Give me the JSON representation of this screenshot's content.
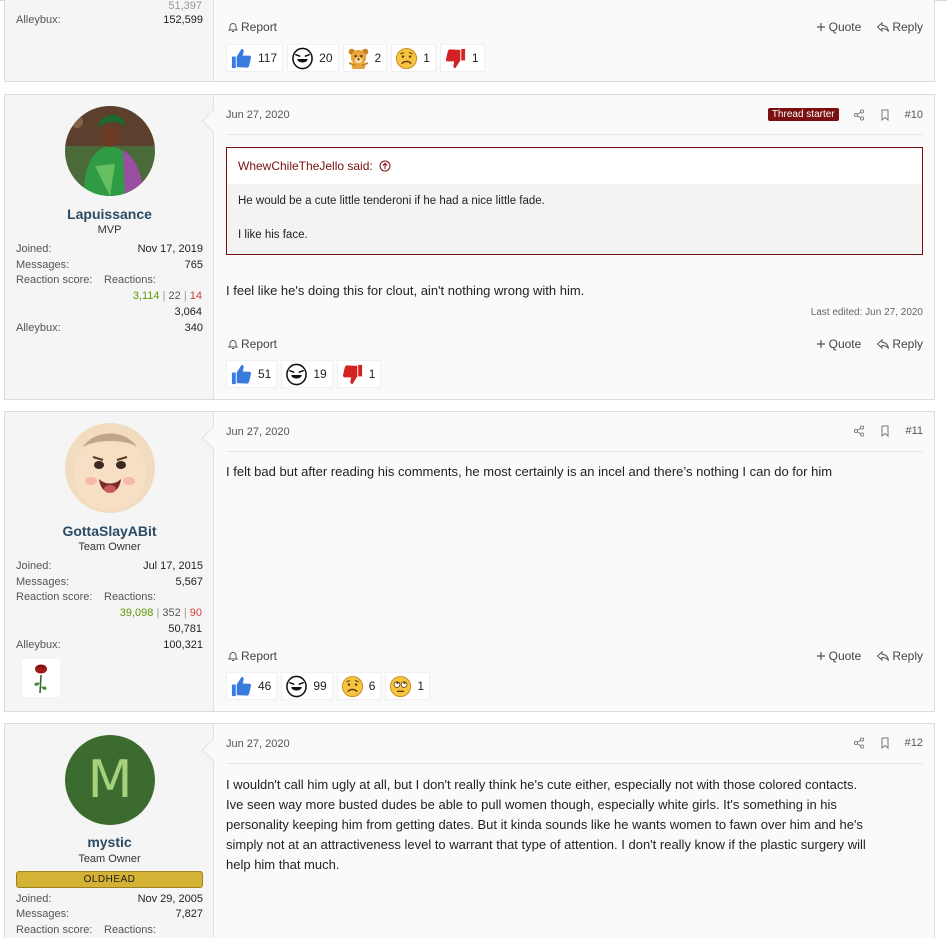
{
  "colors": {
    "accent_dark_red": "#7a1010",
    "username": "#2b4a63",
    "positive": "#5c9900",
    "negative": "#d23c3c",
    "oldhead_banner": "#d4b236"
  },
  "prev_post": {
    "stat_fragment": "51,397",
    "alleybux_label": "Alleybux:",
    "alleybux_value": "152,599",
    "report": "Report",
    "quote": "Quote",
    "reply": "Reply",
    "reactions": [
      {
        "icon": "thumbs-up-icon",
        "count": "117"
      },
      {
        "icon": "laughing-face-icon",
        "count": "20"
      },
      {
        "icon": "bear-icon",
        "count": "2"
      },
      {
        "icon": "sad-face-icon",
        "count": "1"
      },
      {
        "icon": "thumbs-down-icon",
        "count": "1"
      }
    ]
  },
  "posts": [
    {
      "username": "Lapuissance",
      "user_title": "MVP",
      "joined_label": "Joined:",
      "joined": "Nov 17, 2019",
      "messages_label": "Messages:",
      "messages": "765",
      "score_label": "Reaction score:",
      "reactions_label": "Reactions:",
      "score_pos": "3,114",
      "score_neutral": "22",
      "score_neg": "14",
      "score_total": "3,064",
      "alleybux_label": "Alleybux:",
      "alleybux": "340",
      "date": "Jun 27, 2020",
      "thread_starter": "Thread starter",
      "number": "#10",
      "quote_author": "WhewChileTheJello said:",
      "quote_line1": "He would be a cute little tenderoni if he had a nice little fade.",
      "quote_line2": "I like his face.",
      "body": "I feel like he's doing this for clout, ain't nothing wrong with him.",
      "last_edited": "Last edited: Jun 27, 2020",
      "report": "Report",
      "quote": "Quote",
      "reply": "Reply",
      "reactions": [
        {
          "icon": "thumbs-up-icon",
          "count": "51"
        },
        {
          "icon": "laughing-face-icon",
          "count": "19"
        },
        {
          "icon": "thumbs-down-icon",
          "count": "1"
        }
      ]
    },
    {
      "username": "GottaSlayABit",
      "user_title": "Team Owner",
      "joined_label": "Joined:",
      "joined": "Jul 17, 2015",
      "messages_label": "Messages:",
      "messages": "5,567",
      "score_label": "Reaction score:",
      "reactions_label": "Reactions:",
      "score_pos": "39,098",
      "score_neutral": "352",
      "score_neg": "90",
      "score_total": "50,781",
      "alleybux_label": "Alleybux:",
      "alleybux": "100,321",
      "date": "Jun 27, 2020",
      "number": "#11",
      "body": "I felt bad but after reading his comments, he most certainly is an incel and there’s nothing I can do for him",
      "report": "Report",
      "quote": "Quote",
      "reply": "Reply",
      "reactions": [
        {
          "icon": "thumbs-up-icon",
          "count": "46"
        },
        {
          "icon": "laughing-face-icon",
          "count": "99"
        },
        {
          "icon": "sad-face-icon",
          "count": "6"
        },
        {
          "icon": "eye-roll-face-icon",
          "count": "1"
        }
      ]
    },
    {
      "username": "mystic",
      "user_title": "Team Owner",
      "avatar_letter": "M",
      "banner": "OLDHEAD",
      "joined_label": "Joined:",
      "joined": "Nov 29, 2005",
      "messages_label": "Messages:",
      "messages": "7,827",
      "score_label": "Reaction score:",
      "reactions_label": "Reactions:",
      "date": "Jun 27, 2020",
      "number": "#12",
      "body_lines": [
        "I wouldn't call him ugly at all, but I don't really think he's cute either, especially not with those colored contacts.",
        "Ive seen way more busted dudes be able to pull women though, especially white girls. It's something in his",
        "personality keeping him from getting dates. But it kinda sounds like he wants women to fawn over him and he's",
        "simply not at an attractiveness level to warrant that type of attention. I don't really know if the plastic surgery will",
        "help him that much."
      ]
    }
  ]
}
